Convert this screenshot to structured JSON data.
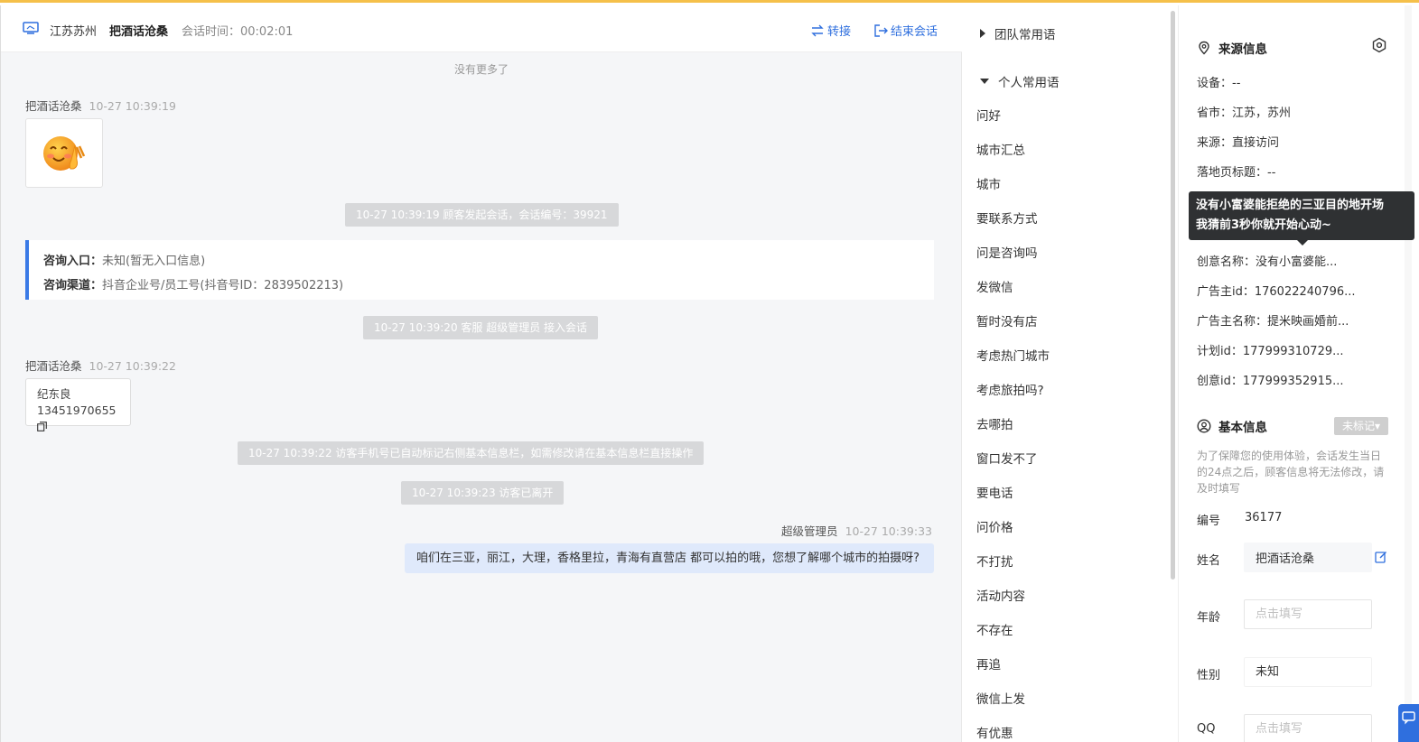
{
  "header": {
    "region": "江苏苏州",
    "visitor_name": "把酒话沧桑",
    "session_time": "会话时间：00:02:01",
    "transfer_label": "转接",
    "end_label": "结束会话"
  },
  "chat": {
    "no_more": "没有更多了",
    "visitor_sender": "把酒话沧桑",
    "msg1_time": "10-27 10:39:19",
    "sys1": "10-27 10:39:19 顾客发起会话，会话编号：39921",
    "consult_entry_label": "咨询入口：",
    "consult_entry_value": "未知(暂无入口信息)",
    "consult_channel_label": "咨询渠道：",
    "consult_channel_value": "抖音企业号/员工号(抖音号ID：2839502213)",
    "sys2": "10-27 10:39:20 客服 超级管理员 接入会话",
    "msg2_time": "10-27 10:39:22",
    "card_name": "纪东良",
    "card_phone": "13451970655",
    "sys3": "10-27 10:39:22 访客手机号已自动标记右侧基本信息栏，如需修改请在基本信息栏直接操作",
    "sys4": "10-27 10:39:23 访客已离开",
    "agent_name": "超级管理员",
    "agent_time": "10-27 10:39:33",
    "agent_message": "咱们在三亚，丽江，大理，香格里拉，青海有直营店 都可以拍的哦，您想了解哪个城市的拍摄呀?"
  },
  "phrases": {
    "team_group": "团队常用语",
    "personal_group": "个人常用语",
    "items": [
      "问好",
      "城市汇总",
      "城市",
      "要联系方式",
      "问是咨询吗",
      "发微信",
      "暂时没有店",
      "考虑热门城市",
      "考虑旅拍吗?",
      "去哪拍",
      "窗口发不了",
      "要电话",
      "问价格",
      "不打扰",
      "活动内容",
      "不存在",
      "再追",
      "微信上发",
      "有优惠"
    ]
  },
  "source_info": {
    "title": "来源信息",
    "rows": [
      "设备：--",
      "省市：江苏，苏州",
      "来源：直接访问",
      "落地页标题：--",
      "创意名称：没有小富婆能...",
      "广告主id：176022240796...",
      "广告主名称：提米映画婚前...",
      "计划id：177999310729...",
      "创意id：177999352915..."
    ],
    "tooltip_line1": "没有小富婆能拒绝的三亚目的地开场",
    "tooltip_line2": "我猜前3秒你就开始心动~"
  },
  "basic_info": {
    "title": "基本信息",
    "tag": "未标记▾",
    "note": "为了保障您的使用体验，会话发生当日的24点之后，顾客信息将无法修改，请及时填写",
    "id_label": "编号",
    "id_value": "36177",
    "name_label": "姓名",
    "name_value": "把酒话沧桑",
    "age_label": "年龄",
    "age_placeholder": "点击填写",
    "gender_label": "性别",
    "gender_value": "未知",
    "qq_label": "QQ",
    "qq_placeholder": "点击填写"
  },
  "colors": {
    "accent": "#2f6fde",
    "consult_border": "#3a7ae6",
    "agent_bubble": "#dfe9fb",
    "tooltip": "#2f3133"
  }
}
